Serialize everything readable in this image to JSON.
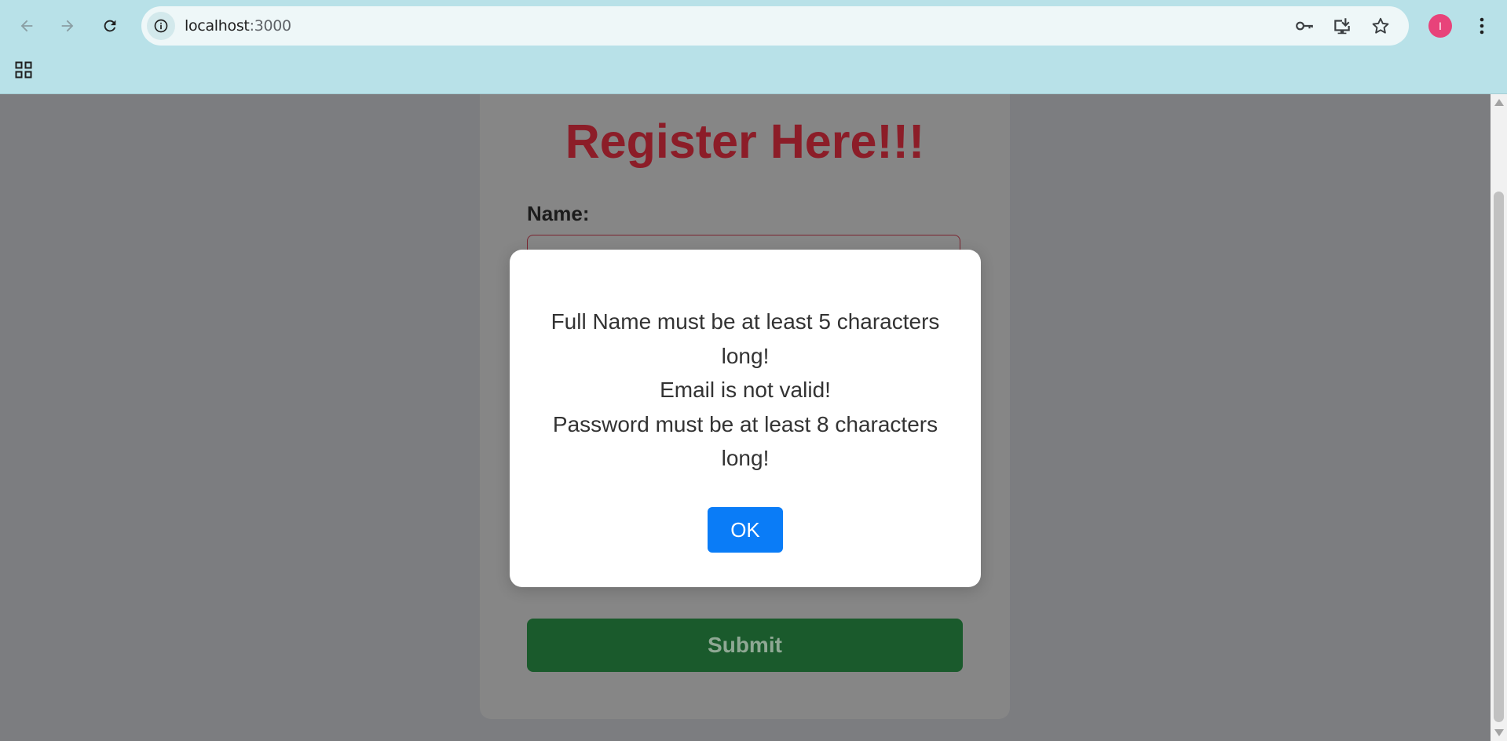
{
  "browser": {
    "url_host": "localhost",
    "url_port": ":3000",
    "avatar_letter": "I",
    "icons": {
      "back": "arrow-left-icon",
      "forward": "arrow-right-icon",
      "reload": "reload-icon",
      "site_info": "info-icon",
      "password": "key-icon",
      "install": "install-app-icon",
      "bookmark": "star-icon",
      "menu": "kebab-menu-icon",
      "apps": "apps-grid-icon"
    },
    "avatar_color": "#e8437a"
  },
  "page": {
    "title": "Register Here!!!",
    "name_label": "Name:",
    "submit_label": "Submit",
    "colors": {
      "title": "#8c1d28",
      "submit": "#1a5a2c",
      "overlay": "#7c7d80"
    }
  },
  "dialog": {
    "messages": [
      "Full Name must be at least 5 characters long!",
      "Email is not valid!",
      "Password must be at least 8 characters long!"
    ],
    "ok_label": "OK",
    "ok_color": "#0a7cf7"
  }
}
